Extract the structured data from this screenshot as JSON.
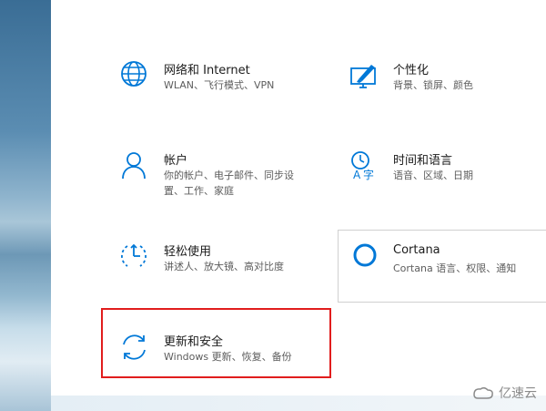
{
  "tiles": [
    {
      "title": "网络和 Internet",
      "desc": "WLAN、飞行模式、VPN",
      "icon": "globe-icon"
    },
    {
      "title": "个性化",
      "desc": "背景、锁屏、颜色",
      "icon": "personalization-icon"
    },
    {
      "title": "帐户",
      "desc": "你的帐户、电子邮件、同步设置、工作、家庭",
      "icon": "account-icon"
    },
    {
      "title": "时间和语言",
      "desc": "语音、区域、日期",
      "icon": "time-language-icon"
    },
    {
      "title": "轻松使用",
      "desc": "讲述人、放大镜、高对比度",
      "icon": "ease-of-access-icon"
    },
    {
      "title": "Cortana",
      "desc": "Cortana 语言、权限、通知",
      "icon": "cortana-icon"
    },
    {
      "title": "更新和安全",
      "desc": "Windows 更新、恢复、备份",
      "icon": "update-icon"
    }
  ],
  "watermark": "亿速云",
  "colors": {
    "accent": "#0078d7",
    "highlight": "#e11d1d"
  }
}
